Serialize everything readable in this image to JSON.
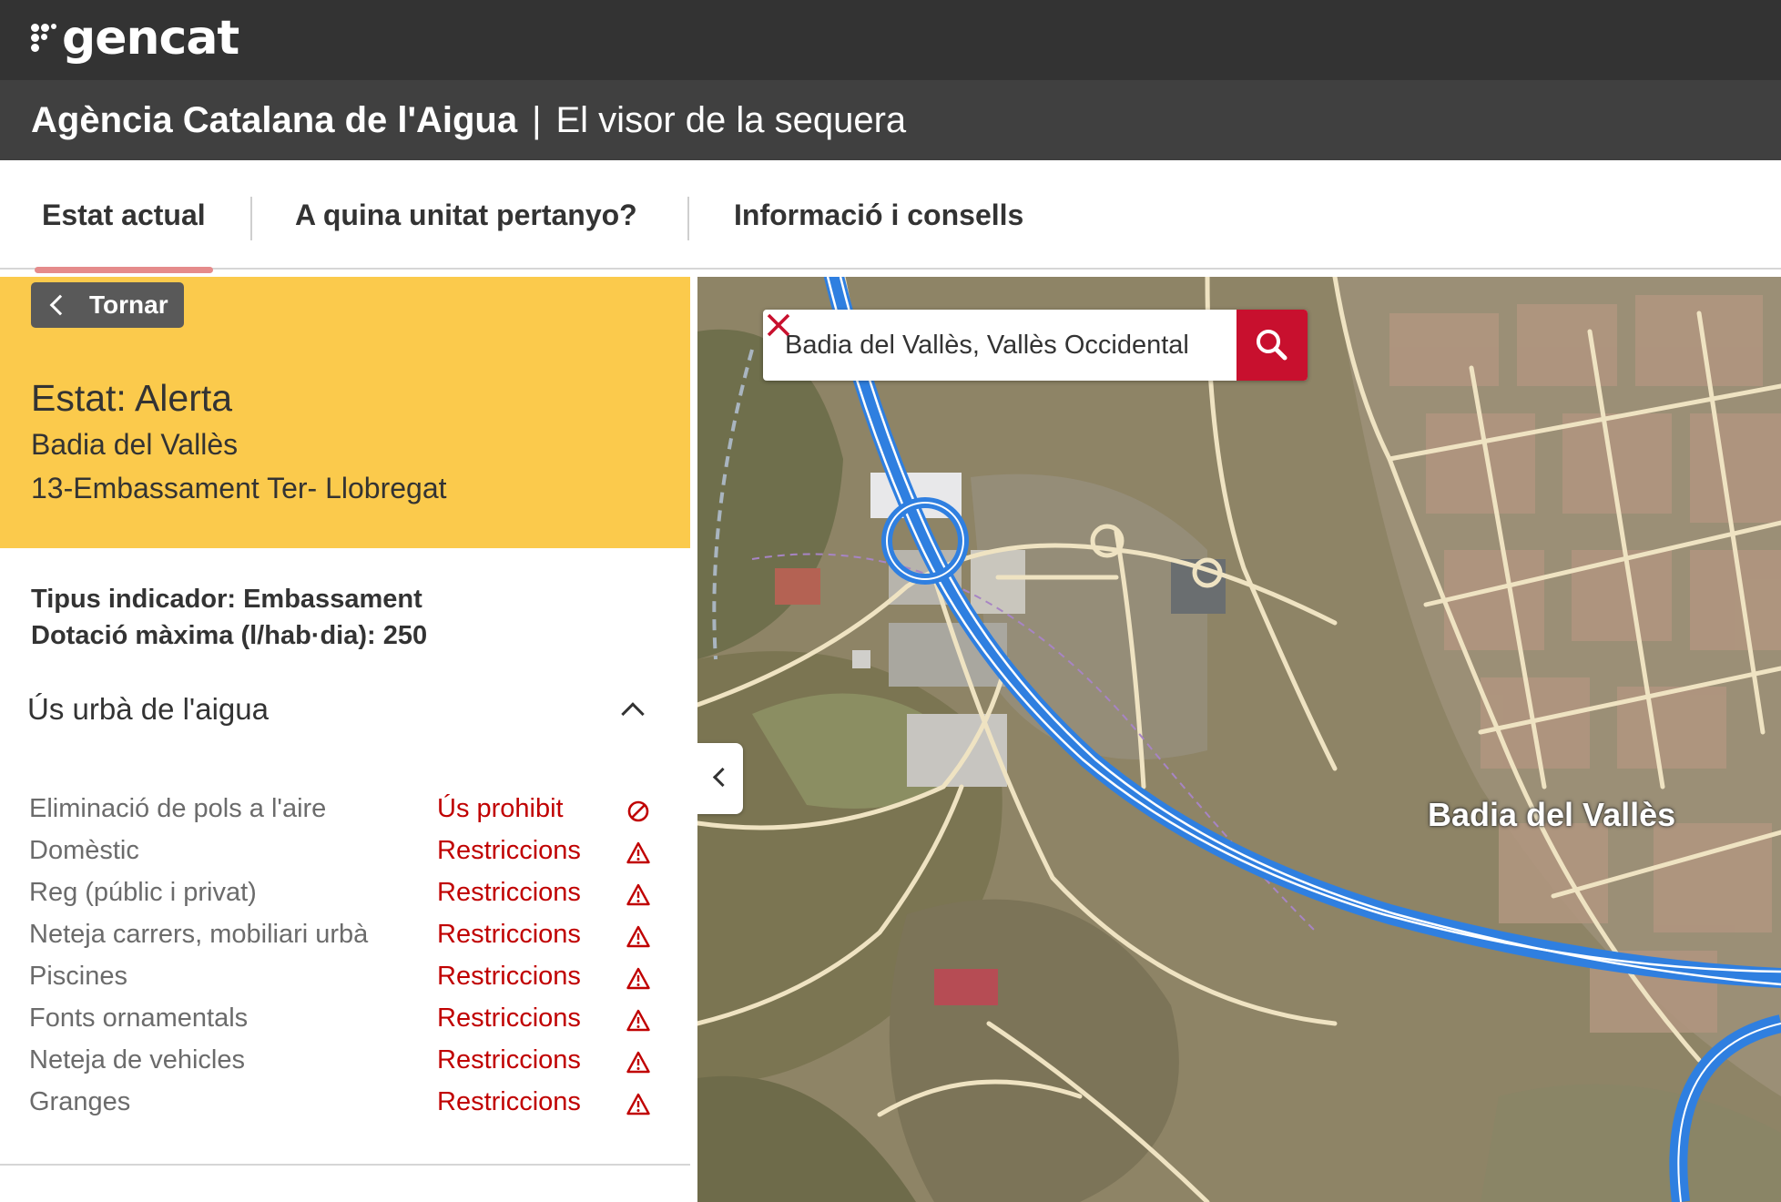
{
  "brand": {
    "logo_text": "gencat"
  },
  "header": {
    "agency_name": "Agència Catalana de l'Aigua",
    "separator": "|",
    "subtitle": "El visor de la sequera"
  },
  "tabs": [
    {
      "label": "Estat actual",
      "active": true
    },
    {
      "label": "A quina unitat pertanyo?"
    },
    {
      "label": "Informació i consells"
    }
  ],
  "panel": {
    "back_label": "Tornar",
    "status_title": "Estat: Alerta",
    "municipality": "Badia del Vallès",
    "unit": "13-Embassament Ter- Llobregat",
    "indicator_type": "Tipus indicador: Embassament",
    "max_allocation": "Dotació màxima (l/hab·dia): 250",
    "section_title": "Ús urbà de l'aigua",
    "status_color": "#fbca4c",
    "uses": [
      {
        "name": "Eliminació de pols a l'aire",
        "status": "Ús prohibit",
        "icon": "prohibited-icon"
      },
      {
        "name": "Domèstic",
        "status": "Restriccions",
        "icon": "warning-icon"
      },
      {
        "name": "Reg (públic i privat)",
        "status": "Restriccions",
        "icon": "warning-icon"
      },
      {
        "name": "Neteja carrers, mobiliari urbà",
        "status": "Restriccions",
        "icon": "warning-icon"
      },
      {
        "name": "Piscines",
        "status": "Restriccions",
        "icon": "warning-icon"
      },
      {
        "name": "Fonts ornamentals",
        "status": "Restriccions",
        "icon": "warning-icon"
      },
      {
        "name": "Neteja de vehicles",
        "status": "Restriccions",
        "icon": "warning-icon"
      },
      {
        "name": "Granges",
        "status": "Restriccions",
        "icon": "warning-icon"
      }
    ]
  },
  "map": {
    "search_value": "Badia del Vallès, Vallès Occidental",
    "place_label": "Badia del Vallès",
    "highway_color": "#2f7fe0",
    "accent_color": "#c8102e"
  }
}
